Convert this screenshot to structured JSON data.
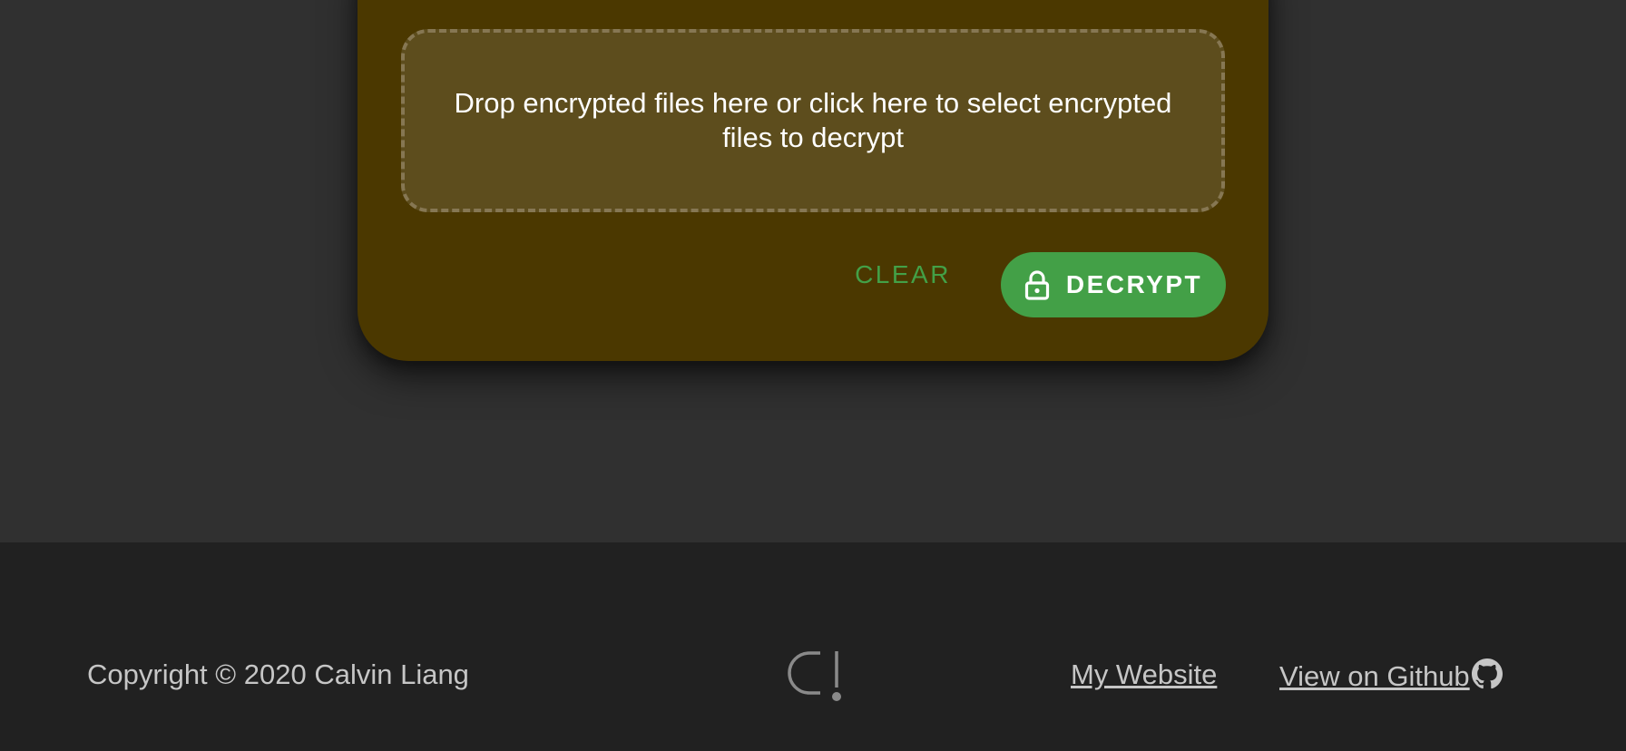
{
  "dropzone": {
    "text": "Drop encrypted files here or click here to select encrypted files to decrypt"
  },
  "actions": {
    "clear_label": "CLEAR",
    "decrypt_label": "DECRYPT",
    "decrypt_icon": "lock-icon"
  },
  "footer": {
    "copyright": "Copyright © 2020 Calvin Liang",
    "logo_icon": "app-logo",
    "website_label": "My Website",
    "github_label": "View on Github",
    "github_icon": "github-icon"
  },
  "colors": {
    "card_bg": "#4b3800",
    "dropzone_bg": "#5d4d1d",
    "accent_green": "#43a047",
    "page_bg": "#303030",
    "footer_bg": "#212121"
  }
}
